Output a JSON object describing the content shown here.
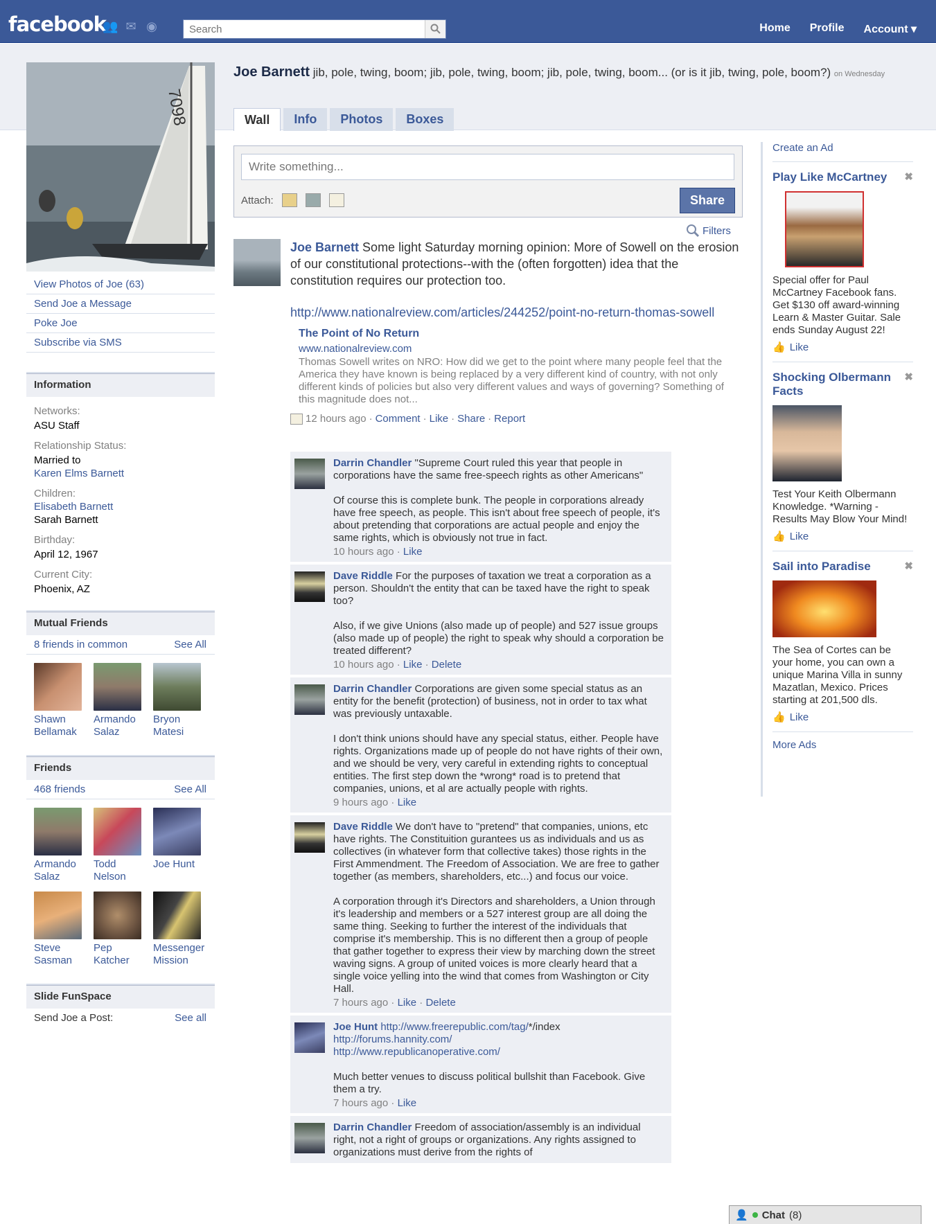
{
  "topbar": {
    "logo": "facebook",
    "search_placeholder": "Search",
    "nav": [
      "Home",
      "Profile",
      "Account ▾"
    ],
    "colors": {
      "brand": "#3b5998"
    }
  },
  "profile": {
    "name": "Joe Barnett",
    "status": "jib, pole, twing, boom; jib, pole, twing, boom; jib, pole, twing, boom... (or is it jib, twing, pole, boom?)",
    "status_time": "on Wednesday",
    "tabs": [
      "Wall",
      "Info",
      "Photos",
      "Boxes"
    ]
  },
  "left": {
    "actions": [
      "View Photos of Joe (63)",
      "Send Joe a Message",
      "Poke Joe",
      "Subscribe via SMS"
    ],
    "information": {
      "heading": "Information",
      "networks_label": "Networks:",
      "networks": "ASU Staff",
      "relationship_label": "Relationship Status:",
      "relationship": "Married to",
      "spouse": "Karen Elms Barnett",
      "children_label": "Children:",
      "child1": "Elisabeth Barnett",
      "child2": "Sarah Barnett",
      "birthday_label": "Birthday:",
      "birthday": "April 12, 1967",
      "city_label": "Current City:",
      "city": "Phoenix, AZ"
    },
    "mutual": {
      "heading": "Mutual Friends",
      "count": "8 friends in common",
      "see_all": "See All",
      "friends": [
        "Shawn Bellamak",
        "Armando Salaz",
        "Bryon Matesi"
      ]
    },
    "friends": {
      "heading": "Friends",
      "count": "468 friends",
      "see_all": "See All",
      "list": [
        "Armando Salaz",
        "Todd Nelson",
        "Joe Hunt",
        "Steve Sasman",
        "Pep Katcher",
        "Messenger Mission"
      ]
    },
    "funspace": {
      "heading": "Slide FunSpace",
      "label": "Send Joe a Post:",
      "see_all": "See all"
    }
  },
  "composer": {
    "placeholder": "Write something...",
    "attach_label": "Attach:",
    "share": "Share"
  },
  "filters": "Filters",
  "post": {
    "author": "Joe Barnett",
    "text": "Some light Saturday morning opinion: More of Sowell on the erosion of our constitutional protections--with the (often forgotten) idea that the constitution requires our protection too.",
    "url": "http://www.nationalreview.com/articles/244252/point-no-return-thomas-sowell",
    "attach_title": "The Point of No Return",
    "attach_host": "www.nationalreview.com",
    "attach_desc": "Thomas Sowell writes on NRO: How did we get to the point where many people feel that the America they have known is being replaced by a very different kind of country, with not only different kinds of policies but also very different values and ways of governing? Something of this magnitude does not...",
    "time": "12 hours ago",
    "actions": [
      "Comment",
      "Like",
      "Share",
      "Report"
    ]
  },
  "comments": [
    {
      "author": "Darrin Chandler",
      "text": "\"Supreme Court ruled this year that people in corporations have the same free-speech rights as other Americans\"\n\nOf course this is complete bunk. The people in corporations already have free speech, as people. This isn't about free speech of people, it's about pretending that corporations are actual people and enjoy the same rights, which is obviously not true in fact.",
      "time": "10 hours ago",
      "actions": [
        "Like"
      ]
    },
    {
      "author": "Dave Riddle",
      "text": "For the purposes of taxation we treat a corporation as a person. Shouldn't the entity that can be taxed have the right to speak too?\n\nAlso, if we give Unions (also made up of people) and 527 issue groups (also made up of people) the right to speak why should a corporation be treated different?",
      "time": "10 hours ago",
      "actions": [
        "Like",
        "Delete"
      ]
    },
    {
      "author": "Darrin Chandler",
      "text": "Corporations are given some special status as an entity for the benefit (protection) of business, not in order to tax what was previously untaxable.\n\nI don't think unions should have any special status, either. People have rights. Organizations made up of people do not have rights of their own, and we should be very, very careful in extending rights to conceptual entities. The first step down the *wrong* road is to pretend that companies, unions, et al are actually people with rights.",
      "time": "9 hours ago",
      "actions": [
        "Like"
      ]
    },
    {
      "author": "Dave Riddle",
      "text": "We don't have to \"pretend\" that companies, unions, etc have rights. The Constituition gurantees us as individuals and us as collectives (in whatever form that collective takes) those rights in the First Ammendment. The Freedom of Association. We are free to gather together (as members, shareholders, etc...) and focus our voice.\n\nA corporation through it's Directors and shareholders, a Union through it's leadership and members or a 527 interest group are all doing the same thing. Seeking to further the interest of the individuals that comprise it's membership. This is no different then a group of people that gather together to express their view by marching down the street waving signs. A group of united voices is more clearly heard that a single voice yelling into the wind that comes from Washington or City Hall.",
      "time": "7 hours ago",
      "actions": [
        "Like",
        "Delete"
      ]
    },
    {
      "author": "Joe Hunt",
      "text": "",
      "links": [
        "http://www.freerepublic.com/tag/",
        "*/index",
        "http://forums.hannity.com/",
        "http://www.republicanoperative.com/"
      ],
      "text2": "Much better venues to discuss political bullshit than Facebook. Give them a try.",
      "time": "7 hours ago",
      "actions": [
        "Like"
      ]
    },
    {
      "author": "Darrin Chandler",
      "text": "Freedom of association/assembly is an individual right, not a right of groups or organizations. Any rights assigned to organizations must derive from the rights of",
      "time": "",
      "actions": []
    }
  ],
  "ads": {
    "create": "Create an Ad",
    "items": [
      {
        "title": "Play Like McCartney",
        "body": "Special offer for Paul McCartney Facebook fans. Get $130 off award-winning Learn & Master Guitar. Sale ends Sunday August 22!",
        "like": "Like"
      },
      {
        "title": "Shocking Olbermann Facts",
        "body": "Test Your Keith Olbermann Knowledge. *Warning - Results May Blow Your Mind!",
        "like": "Like"
      },
      {
        "title": "Sail into Paradise",
        "body": "The Sea of Cortes can be your home, you can own a unique Marina Villa in sunny Mazatlan, Mexico. Prices starting at 201,500 dls.",
        "like": "Like"
      }
    ],
    "more": "More Ads"
  },
  "chat": {
    "label": "Chat",
    "count": "(8)"
  }
}
